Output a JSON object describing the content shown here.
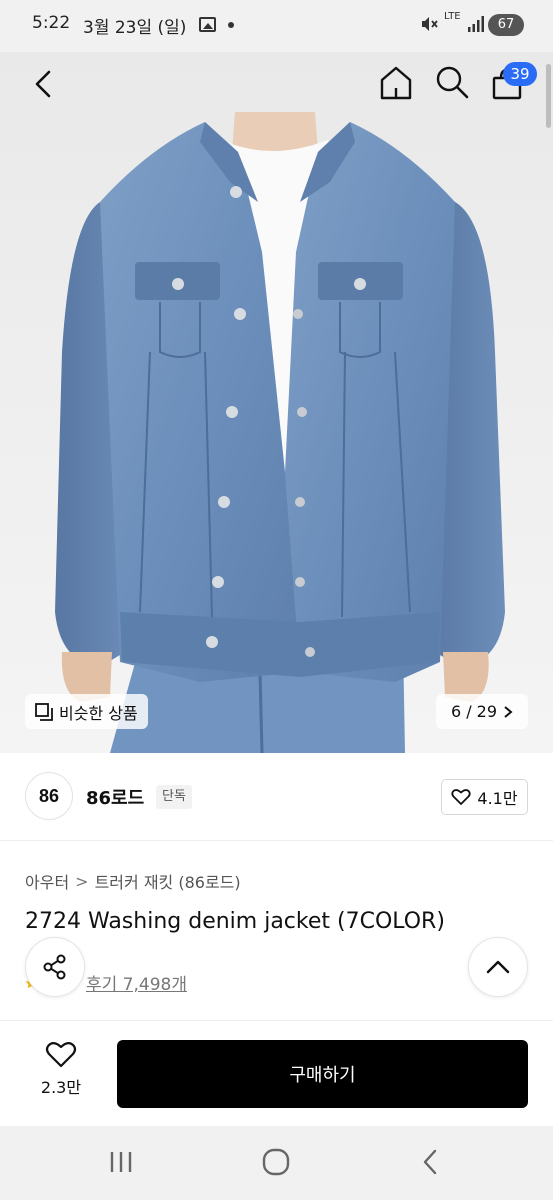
{
  "status_bar": {
    "time": "5:22",
    "date": "3월 23일 (일)",
    "network": "LTE",
    "battery": "67"
  },
  "header": {
    "back_icon": "chevron-left-icon",
    "home_icon": "home-icon",
    "search_icon": "search-icon",
    "cart_icon": "shopping-bag-icon",
    "cart_count": "39"
  },
  "gallery": {
    "similar_label": "비슷한 상품",
    "page_counter": "6 / 29"
  },
  "brand": {
    "logo_text": "86",
    "name": "86로드",
    "tag": "단독",
    "likes": "4.1만"
  },
  "product": {
    "breadcrumb": [
      "아우터",
      "트러커 재킷 (86로드)"
    ],
    "title": "2724 Washing denim jacket (7COLOR)",
    "review_link": "후기 7,498개"
  },
  "actions": {
    "wish_count": "2.3만",
    "buy_label": "구매하기"
  },
  "colors": {
    "accent_badge": "#2a6cf5",
    "buy_button": "#000000",
    "denim": "#6f93bd"
  }
}
